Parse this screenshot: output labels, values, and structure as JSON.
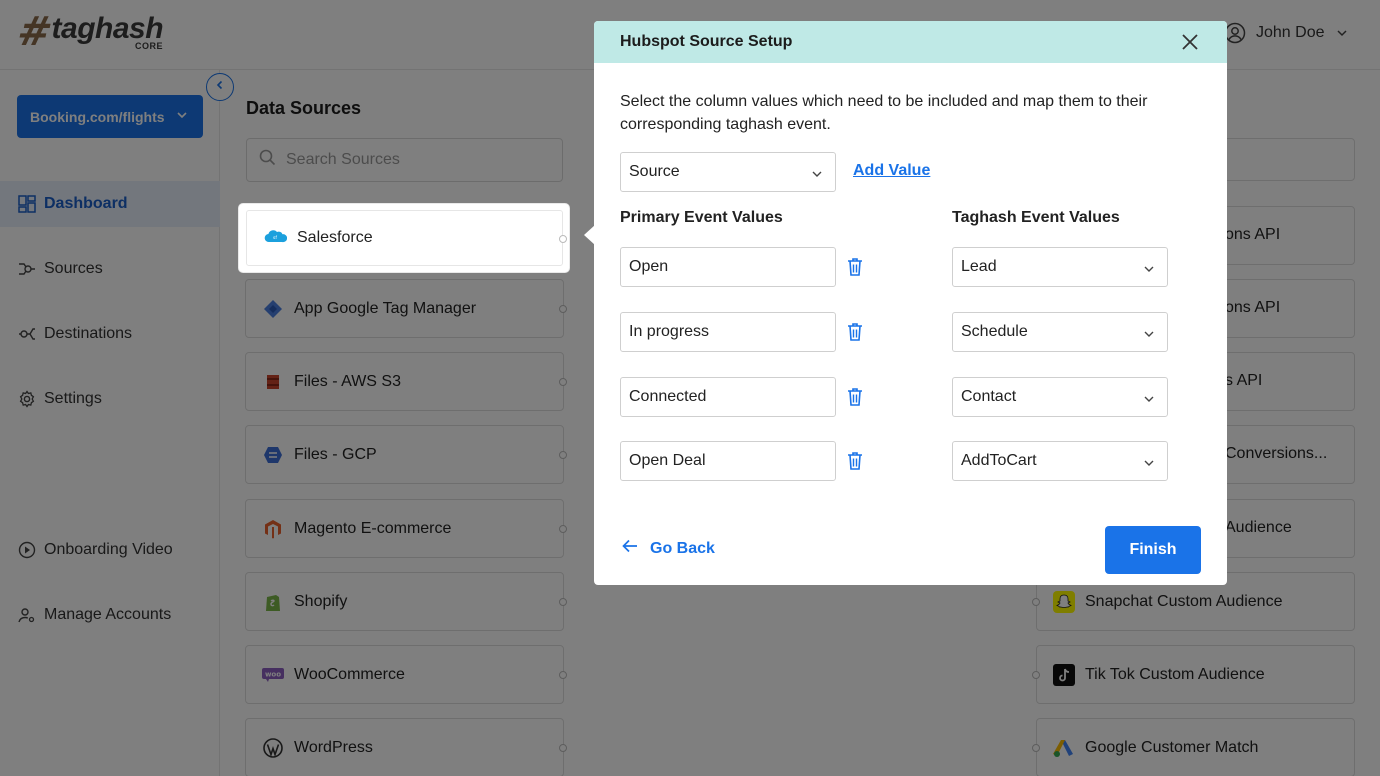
{
  "app": {
    "logo_text": "taghash",
    "logo_sub": "CORE",
    "user_name": "John Doe"
  },
  "sidebar": {
    "account_label": "Booking.com/flights",
    "items": [
      {
        "label": "Dashboard",
        "icon": "dashboard-icon",
        "active": true
      },
      {
        "label": "Sources",
        "icon": "sources-icon"
      },
      {
        "label": "Destinations",
        "icon": "destinations-icon"
      },
      {
        "label": "Settings",
        "icon": "gear-icon"
      },
      {
        "label": "Onboarding Video",
        "icon": "play-icon"
      },
      {
        "label": "Manage Accounts",
        "icon": "manage-accounts-icon"
      }
    ]
  },
  "content": {
    "title": "Data Sources",
    "search_placeholder": "Search Sources",
    "sources": [
      {
        "label": "Salesforce",
        "icon": "salesforce-icon"
      },
      {
        "label": "App Google Tag Manager",
        "icon": "google-tag-manager-icon"
      },
      {
        "label": "Files - AWS S3",
        "icon": "aws-s3-icon"
      },
      {
        "label": "Files - GCP",
        "icon": "gcp-icon"
      },
      {
        "label": "Magento E-commerce",
        "icon": "magento-icon"
      },
      {
        "label": "Shopify",
        "icon": "shopify-icon"
      },
      {
        "label": "WooCommerce",
        "icon": "woocommerce-icon"
      },
      {
        "label": "WordPress",
        "icon": "wordpress-icon"
      }
    ],
    "destinations": [
      {
        "label": "ons API"
      },
      {
        "label": "ons API"
      },
      {
        "label": "s API"
      },
      {
        "label": "Conversions..."
      },
      {
        "label": "Audience"
      },
      {
        "label": "Snapchat Custom Audience",
        "icon": "snapchat-icon"
      },
      {
        "label": "Tik Tok Custom Audience",
        "icon": "tiktok-icon"
      },
      {
        "label": "Google Customer Match",
        "icon": "google-ads-icon"
      }
    ]
  },
  "modal": {
    "title": "Hubspot Source Setup",
    "description": "Select the column values which need to be included and map them to their corresponding taghash event.",
    "column_select": "Source",
    "add_value_label": "Add Value",
    "primary_header": "Primary Event Values",
    "taghash_header": "Taghash Event Values",
    "rows": [
      {
        "primary": "Open",
        "taghash": "Lead"
      },
      {
        "primary": "In progress",
        "taghash": "Schedule"
      },
      {
        "primary": "Connected",
        "taghash": "Contact"
      },
      {
        "primary": "Open Deal",
        "taghash": "AddToCart"
      }
    ],
    "go_back_label": "Go Back",
    "finish_label": "Finish"
  },
  "colors": {
    "accent": "#1a73e8",
    "modal_header": "#bfe9e6",
    "overlay": "rgba(0,0,0,0.5)"
  }
}
